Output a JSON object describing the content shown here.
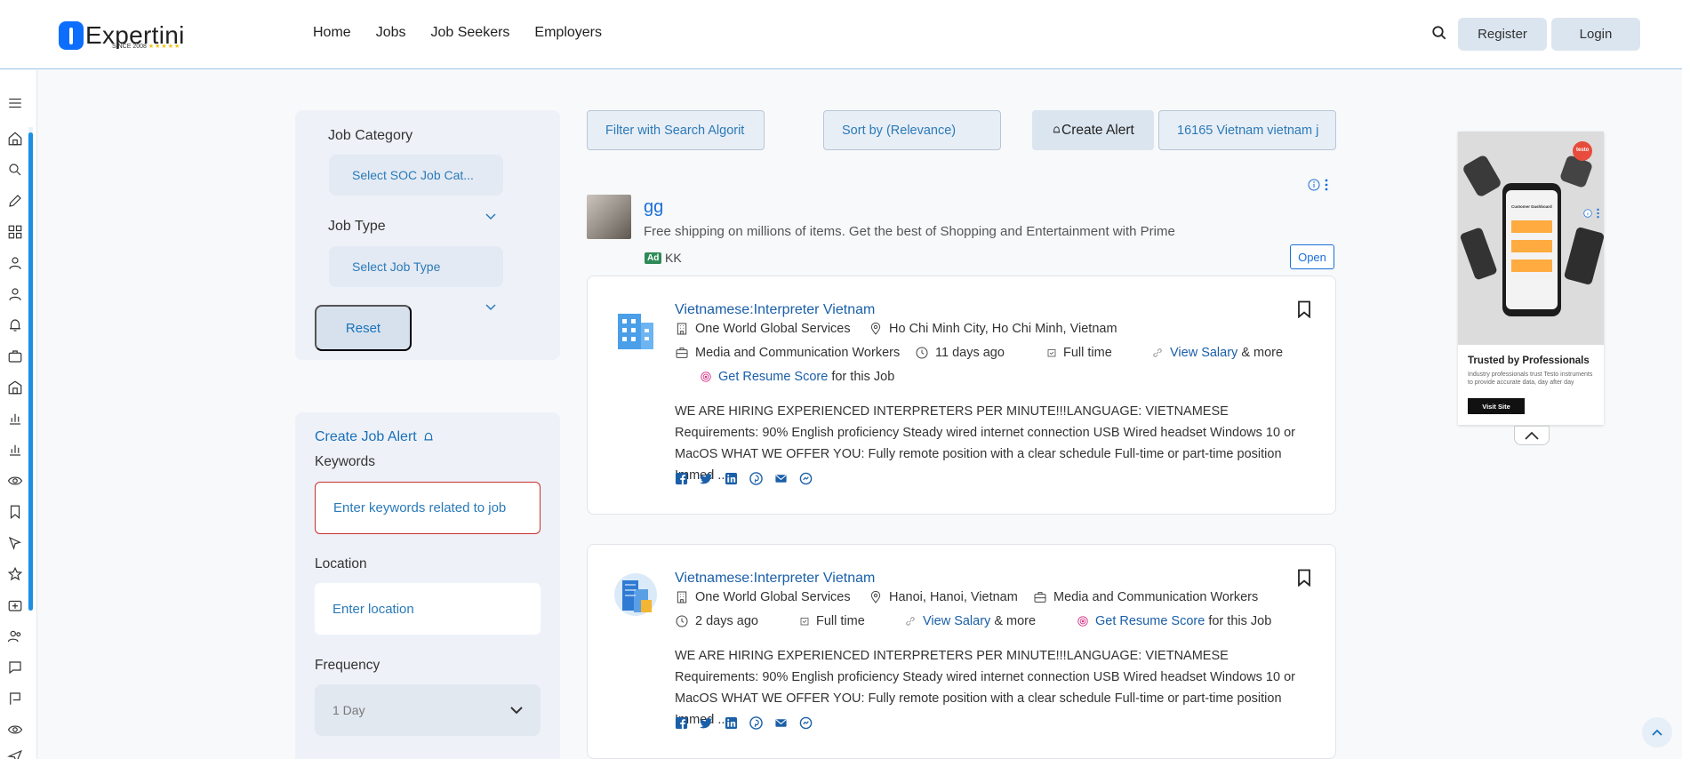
{
  "brand": {
    "name": "Expertini",
    "since": "SINCE 2008",
    "stars": "★★★★★"
  },
  "nav": {
    "links": [
      "Home",
      "Jobs",
      "Job Seekers",
      "Employers"
    ],
    "register": "Register",
    "login": "Login"
  },
  "sidebar_icons": [
    "menu-icon",
    "home-icon",
    "search-icon",
    "pencil-icon",
    "grid-icon",
    "user-icon",
    "user-icon",
    "bell-icon",
    "briefcase-icon",
    "building-icon",
    "chart-icon",
    "chart-icon",
    "eye-icon",
    "bookmark-icon",
    "cursor-icon",
    "star-icon",
    "badge-icon",
    "users-icon",
    "chat-icon",
    "flag-icon",
    "eye-icon",
    "send-icon"
  ],
  "filters": {
    "job_category_label": "Job Category",
    "job_category_placeholder": "Select SOC Job Cat...",
    "job_type_label": "Job Type",
    "job_type_placeholder": "Select Job Type",
    "reset": "Reset"
  },
  "alert_panel": {
    "title": "Create Job Alert",
    "keywords_label": "Keywords",
    "keywords_placeholder": "Enter keywords related to job",
    "location_label": "Location",
    "location_placeholder": "Enter location",
    "frequency_label": "Frequency",
    "frequency_value": "1 Day"
  },
  "toolbar": {
    "filter": "Filter with Search Algorit",
    "sort": "Sort by (Relevance)",
    "create_alert": "Create Alert",
    "count": "16165 Vietnam vietnam j"
  },
  "ad": {
    "title": "gg",
    "description": "Free shipping on millions of items. Get the best of Shopping and Entertainment with Prime",
    "badge": "Ad",
    "source": "KK",
    "open": "Open"
  },
  "jobs": [
    {
      "title": "Vietnamese:Interpreter Vietnam",
      "company": "One World Global Services",
      "location": "Ho Chi Minh City, Ho Chi Minh, Vietnam",
      "category": "Media and Communication Workers",
      "posted": "11 days ago",
      "type": "Full time",
      "salary_link": "View Salary",
      "salary_more": "& more",
      "resume_link": "Get Resume Score",
      "resume_more": "for this Job",
      "description": "WE ARE HIRING EXPERIENCED INTERPRETERS PER MINUTE!!!LANGUAGE: VIETNAMESE  Requirements: 90% English proficiency  Steady wired internet connection USB Wired headset Windows 10 or MacOS WHAT WE OFFER YOU: Fully remote position with a clear schedule Full-time or part-time position Immed ..."
    },
    {
      "title": "Vietnamese:Interpreter Vietnam",
      "company": "One World Global Services",
      "location": "Hanoi, Hanoi, Vietnam",
      "category": "Media and Communication Workers",
      "posted": "2 days ago",
      "type": "Full time",
      "salary_link": "View Salary",
      "salary_more": "& more",
      "resume_link": "Get Resume Score",
      "resume_more": "for this Job",
      "description": "WE ARE HIRING EXPERIENCED INTERPRETERS PER MINUTE!!!LANGUAGE: VIETNAMESE  Requirements: 90% English proficiency  Steady wired internet connection USB Wired headset Windows 10 or MacOS WHAT WE OFFER YOU: Fully remote position with a clear schedule Full-time or part-time position Immed ..."
    }
  ],
  "side_ad": {
    "brand": "testo",
    "screen_title": "Customer Dashboard",
    "title": "Trusted by Professionals",
    "text": "Industry professionals trust Testo instruments to provide accurate data, day after day",
    "button": "Visit Site"
  },
  "colors": {
    "accent": "#1a73b8",
    "nav_button": "#dbe5f0",
    "panel": "#eef2f8"
  }
}
